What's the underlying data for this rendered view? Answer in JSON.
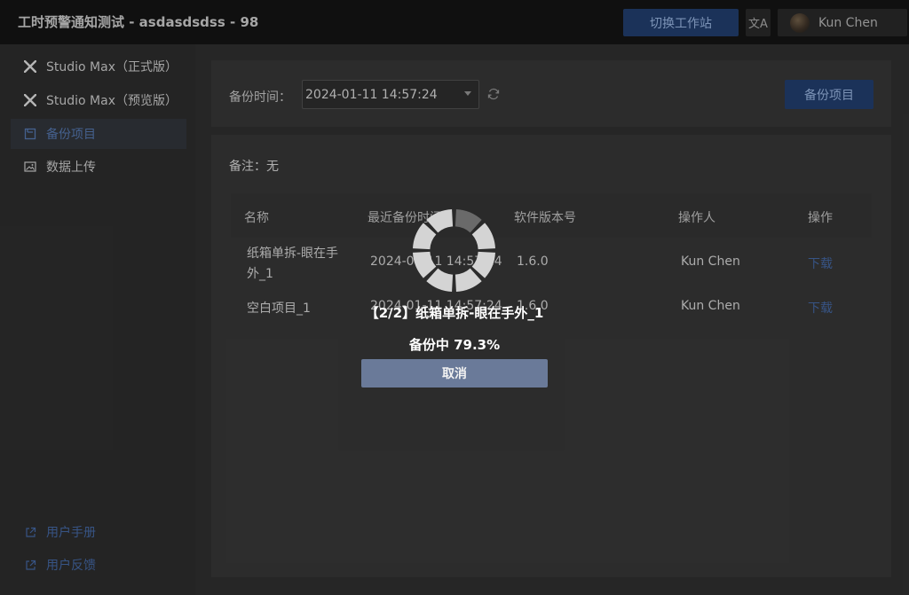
{
  "header": {
    "app_title": "工时预警通知测试 - asdasdsdss - 98",
    "switch_workstation": "切换工作站",
    "lang_icon": "translate-icon",
    "user_name": "Kun Chen"
  },
  "sidebar": {
    "items": [
      {
        "label": "Studio Max（正式版）",
        "icon": "x-logo-icon"
      },
      {
        "label": "Studio Max（预览版）",
        "icon": "x-logo-icon"
      },
      {
        "label": "备份项目",
        "icon": "backup-icon",
        "active": true
      },
      {
        "label": "数据上传",
        "icon": "image-icon"
      }
    ],
    "footer": [
      {
        "label": "用户手册",
        "icon": "external-link-icon"
      },
      {
        "label": "用户反馈",
        "icon": "external-link-icon"
      }
    ]
  },
  "toolbar": {
    "time_label": "备份时间：",
    "time_value": "2024-01-11 14:57:24",
    "backup_button": "备份项目"
  },
  "remark": "备注：无",
  "table": {
    "columns": [
      "名称",
      "最近备份时间",
      "软件版本号",
      "操作人",
      "操作"
    ],
    "rows": [
      {
        "name_line1": "纸箱单拆-眼在手",
        "name_line2": "外_1",
        "time": "2024-01-11 14:57:24",
        "version": "1.6.0",
        "operator": "Kun Chen",
        "action": "下载"
      },
      {
        "name_line1": "空白项目_1",
        "name_line2": "",
        "time": "2024-01-11 14:57:24",
        "version": "1.6.0",
        "operator": "Kun Chen",
        "action": "下载"
      }
    ]
  },
  "overlay": {
    "title": "【2/2】纸箱单拆-眼在手外_1",
    "progress_text": "备份中 79.3%",
    "progress": 0.793,
    "cancel_button": "取消"
  }
}
